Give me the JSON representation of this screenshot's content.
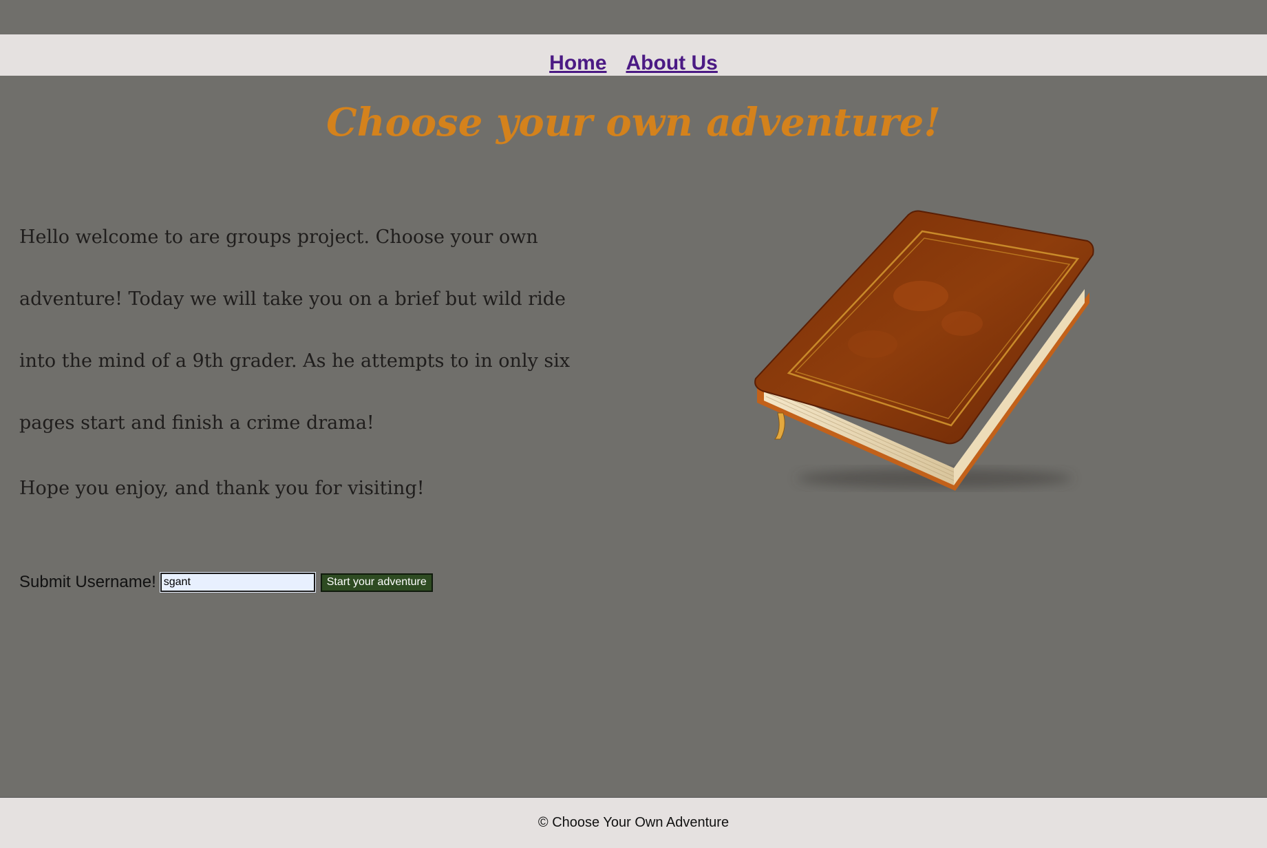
{
  "nav": {
    "home": "Home",
    "about": "About Us"
  },
  "title": "Choose your own adventure!",
  "intro": "Hello welcome to are groups project. Choose your own adventure! Today we will take you on a brief but wild ride into the mind of a 9th grader. As he attempts to in only six pages start and finish a crime drama!",
  "thanks": "Hope you enjoy, and thank you for visiting!",
  "form": {
    "label": "Submit Username!",
    "input_value": "sgant",
    "button": "Start your adventure"
  },
  "footer": "© Choose Your Own Adventure",
  "colors": {
    "background": "#706f6b",
    "nav_bg": "#e5e1e0",
    "link": "#4b1a84",
    "title": "#d4821c",
    "button_bg": "#2e4b22"
  }
}
